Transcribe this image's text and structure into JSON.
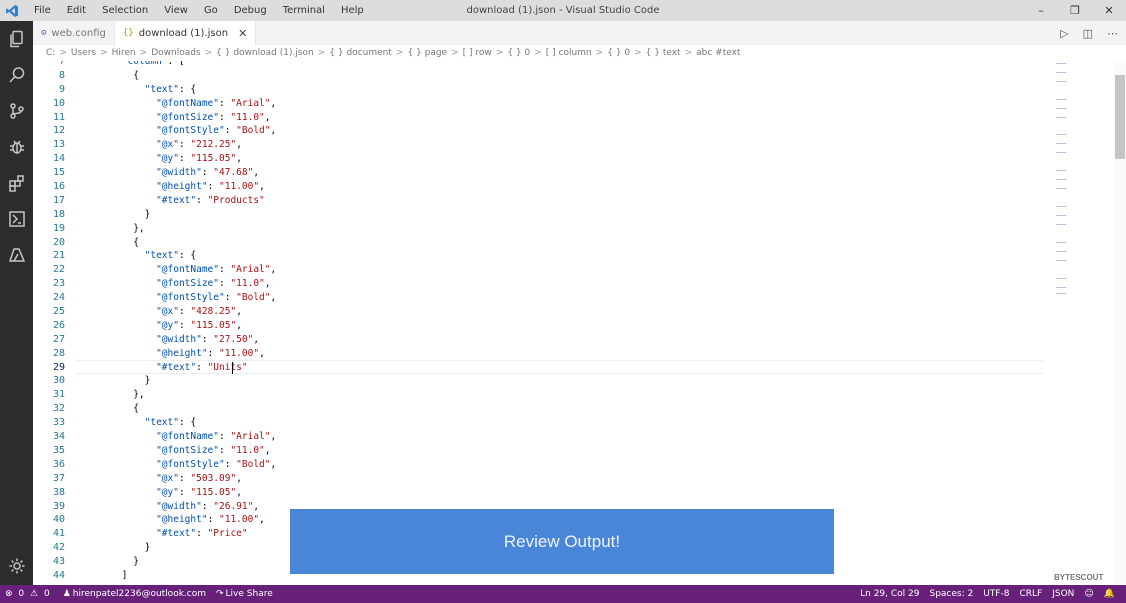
{
  "titlebar": {
    "menu": [
      "File",
      "Edit",
      "Selection",
      "View",
      "Go",
      "Debug",
      "Terminal",
      "Help"
    ],
    "title": "download (1).json - Visual Studio Code"
  },
  "tabs": [
    {
      "label": "web.config",
      "active": false
    },
    {
      "label": "download (1).json",
      "active": true,
      "close": "✕"
    }
  ],
  "breadcrumbs": [
    "C:",
    "Users",
    "Hiren",
    "Downloads",
    "{ } download (1).json",
    "{ } document",
    "{ } page",
    "[ ] row",
    "{ } 0",
    "[ ] column",
    "{ } 0",
    "{ } text",
    "abc #text"
  ],
  "editor": {
    "first_line": 7,
    "current_line": 29,
    "lines": [
      "        \"column\": [",
      "          {",
      "            \"text\": {",
      "              \"@fontName\": \"Arial\",",
      "              \"@fontSize\": \"11.0\",",
      "              \"@fontStyle\": \"Bold\",",
      "              \"@x\": \"212.25\",",
      "              \"@y\": \"115.05\",",
      "              \"@width\": \"47.68\",",
      "              \"@height\": \"11.00\",",
      "              \"#text\": \"Products\"",
      "            }",
      "          },",
      "          {",
      "            \"text\": {",
      "              \"@fontName\": \"Arial\",",
      "              \"@fontSize\": \"11.0\",",
      "              \"@fontStyle\": \"Bold\",",
      "              \"@x\": \"428.25\",",
      "              \"@y\": \"115.05\",",
      "              \"@width\": \"27.50\",",
      "              \"@height\": \"11.00\",",
      "              \"#text\": \"Units\"",
      "            }",
      "          },",
      "          {",
      "            \"text\": {",
      "              \"@fontName\": \"Arial\",",
      "              \"@fontSize\": \"11.0\",",
      "              \"@fontStyle\": \"Bold\",",
      "              \"@x\": \"503.09\",",
      "              \"@y\": \"115.05\",",
      "              \"@width\": \"26.91\",",
      "              \"@height\": \"11.00\",",
      "              \"#text\": \"Price\"",
      "            }",
      "          }",
      "        ]"
    ]
  },
  "overlay": {
    "label": "Review Output!"
  },
  "watermark": "BYTESCOUT",
  "statusbar": {
    "errors": "0",
    "warnings": "0",
    "user": "hirenpatel2236@outlook.com",
    "live_share": "Live Share",
    "position": "Ln 29, Col 29",
    "spaces": "Spaces: 2",
    "encoding": "UTF-8",
    "eol": "CRLF",
    "language": "JSON"
  },
  "colors": {
    "statusbar": "#68217a",
    "activitybar": "#2c2c2c",
    "overlay": "#4a86d8",
    "key": "#0451a5",
    "string": "#a31515"
  }
}
